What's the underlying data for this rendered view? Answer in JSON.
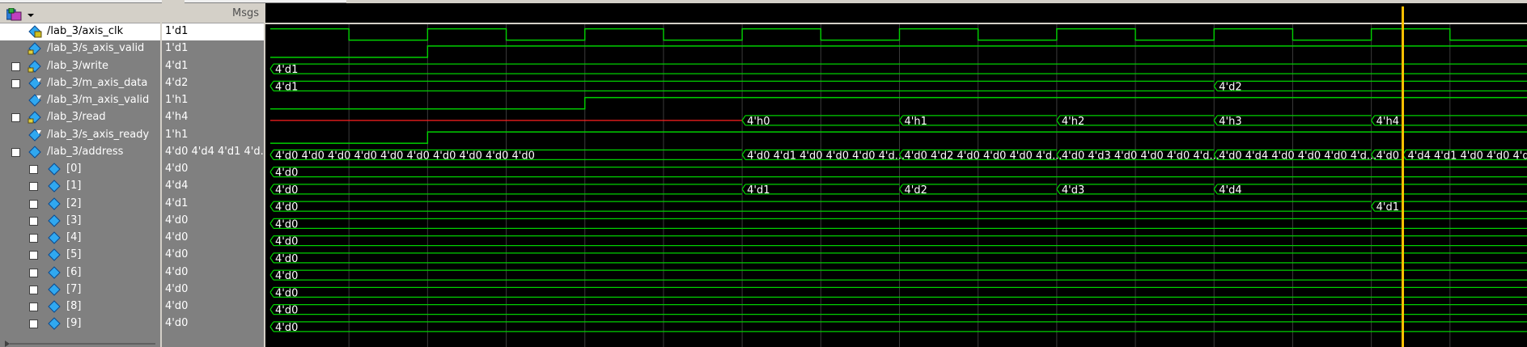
{
  "header": {
    "msgs_label": "Msgs"
  },
  "signals": [
    {
      "name": "/lab_3/axis_clk",
      "value": "1'd1",
      "icon": "clock-signal-icon",
      "expand": "",
      "selected": true
    },
    {
      "name": "/lab_3/s_axis_valid",
      "value": "1'd1",
      "icon": "input-signal-icon",
      "expand": ""
    },
    {
      "name": "/lab_3/write",
      "value": "4'd1",
      "icon": "input-signal-icon",
      "expand": "+"
    },
    {
      "name": "/lab_3/m_axis_data",
      "value": "4'd2",
      "icon": "output-signal-icon",
      "expand": "+"
    },
    {
      "name": "/lab_3/m_axis_valid",
      "value": "1'h1",
      "icon": "output-signal-icon",
      "expand": ""
    },
    {
      "name": "/lab_3/read",
      "value": "4'h4",
      "icon": "input-signal-icon",
      "expand": "+"
    },
    {
      "name": "/lab_3/s_axis_ready",
      "value": "1'h1",
      "icon": "output-signal-icon",
      "expand": ""
    },
    {
      "name": "/lab_3/address",
      "value": "4'd0 4'd4 4'd1 4'd...",
      "icon": "internal-signal-icon",
      "expand": "-"
    },
    {
      "name": "[0]",
      "value": "4'd0",
      "icon": "internal-signal-icon",
      "expand": "+",
      "indent": true
    },
    {
      "name": "[1]",
      "value": "4'd4",
      "icon": "internal-signal-icon",
      "expand": "+",
      "indent": true
    },
    {
      "name": "[2]",
      "value": "4'd1",
      "icon": "internal-signal-icon",
      "expand": "+",
      "indent": true
    },
    {
      "name": "[3]",
      "value": "4'd0",
      "icon": "internal-signal-icon",
      "expand": "+",
      "indent": true
    },
    {
      "name": "[4]",
      "value": "4'd0",
      "icon": "internal-signal-icon",
      "expand": "+",
      "indent": true
    },
    {
      "name": "[5]",
      "value": "4'd0",
      "icon": "internal-signal-icon",
      "expand": "+",
      "indent": true
    },
    {
      "name": "[6]",
      "value": "4'd0",
      "icon": "internal-signal-icon",
      "expand": "+",
      "indent": true
    },
    {
      "name": "[7]",
      "value": "4'd0",
      "icon": "internal-signal-icon",
      "expand": "+",
      "indent": true
    },
    {
      "name": "[8]",
      "value": "4'd0",
      "icon": "internal-signal-icon",
      "expand": "+",
      "indent": true
    },
    {
      "name": "[9]",
      "value": "4'd0",
      "icon": "internal-signal-icon",
      "expand": "+",
      "indent": true
    }
  ],
  "waveform": {
    "period": 10,
    "time_end": 160,
    "cursor_time": 144,
    "colors": {
      "wave": "#00d000",
      "error": "#ff2020",
      "cursor": "#ffc000",
      "grid": "#3a3a3a"
    },
    "clock": {
      "row": 0,
      "start_level": 1
    },
    "digital": [
      {
        "row": 1,
        "transitions": [
          [
            0,
            0
          ],
          [
            20,
            1
          ]
        ]
      },
      {
        "row": 4,
        "transitions": [
          [
            0,
            0
          ],
          [
            40,
            1
          ]
        ]
      },
      {
        "row": 6,
        "transitions": [
          [
            0,
            0
          ],
          [
            20,
            1
          ]
        ]
      }
    ],
    "buses": [
      {
        "row": 2,
        "segments": [
          {
            "t": 0,
            "label": "4'd1"
          }
        ]
      },
      {
        "row": 3,
        "segments": [
          {
            "t": 0,
            "label": "4'd1"
          },
          {
            "t": 120,
            "label": "4'd2"
          }
        ]
      },
      {
        "row": 5,
        "segments": [
          {
            "t": 0,
            "label": "",
            "error": true
          },
          {
            "t": 60,
            "label": "4'h0"
          },
          {
            "t": 80,
            "label": "4'h1"
          },
          {
            "t": 100,
            "label": "4'h2"
          },
          {
            "t": 120,
            "label": "4'h3"
          },
          {
            "t": 140,
            "label": "4'h4"
          }
        ]
      },
      {
        "row": 7,
        "segments": [
          {
            "t": 0,
            "label": "4'd0 4'd0 4'd0 4'd0 4'd0 4'd0 4'd0 4'd0 4'd0 4'd0"
          },
          {
            "t": 60,
            "label": "4'd0 4'd1 4'd0 4'd0 4'd0 4'd..."
          },
          {
            "t": 80,
            "label": "4'd0 4'd2 4'd0 4'd0 4'd0 4'd..."
          },
          {
            "t": 100,
            "label": "4'd0 4'd3 4'd0 4'd0 4'd0 4'd..."
          },
          {
            "t": 120,
            "label": "4'd0 4'd4 4'd0 4'd0 4'd0 4'd..."
          },
          {
            "t": 140,
            "label": "4'd0"
          },
          {
            "t": 144,
            "label": "4'd4 4'd1 4'd0 4'd0 4'd..."
          }
        ]
      },
      {
        "row": 8,
        "segments": [
          {
            "t": 0,
            "label": "4'd0"
          }
        ]
      },
      {
        "row": 9,
        "segments": [
          {
            "t": 0,
            "label": "4'd0"
          },
          {
            "t": 60,
            "label": "4'd1"
          },
          {
            "t": 80,
            "label": "4'd2"
          },
          {
            "t": 100,
            "label": "4'd3"
          },
          {
            "t": 120,
            "label": "4'd4"
          }
        ]
      },
      {
        "row": 10,
        "segments": [
          {
            "t": 0,
            "label": "4'd0"
          },
          {
            "t": 140,
            "label": "4'd1"
          }
        ]
      },
      {
        "row": 11,
        "segments": [
          {
            "t": 0,
            "label": "4'd0"
          }
        ]
      },
      {
        "row": 12,
        "segments": [
          {
            "t": 0,
            "label": "4'd0"
          }
        ]
      },
      {
        "row": 13,
        "segments": [
          {
            "t": 0,
            "label": "4'd0"
          }
        ]
      },
      {
        "row": 14,
        "segments": [
          {
            "t": 0,
            "label": "4'd0"
          }
        ]
      },
      {
        "row": 15,
        "segments": [
          {
            "t": 0,
            "label": "4'd0"
          }
        ]
      },
      {
        "row": 16,
        "segments": [
          {
            "t": 0,
            "label": "4'd0"
          }
        ]
      },
      {
        "row": 17,
        "segments": [
          {
            "t": 0,
            "label": "4'd0"
          }
        ]
      }
    ]
  }
}
